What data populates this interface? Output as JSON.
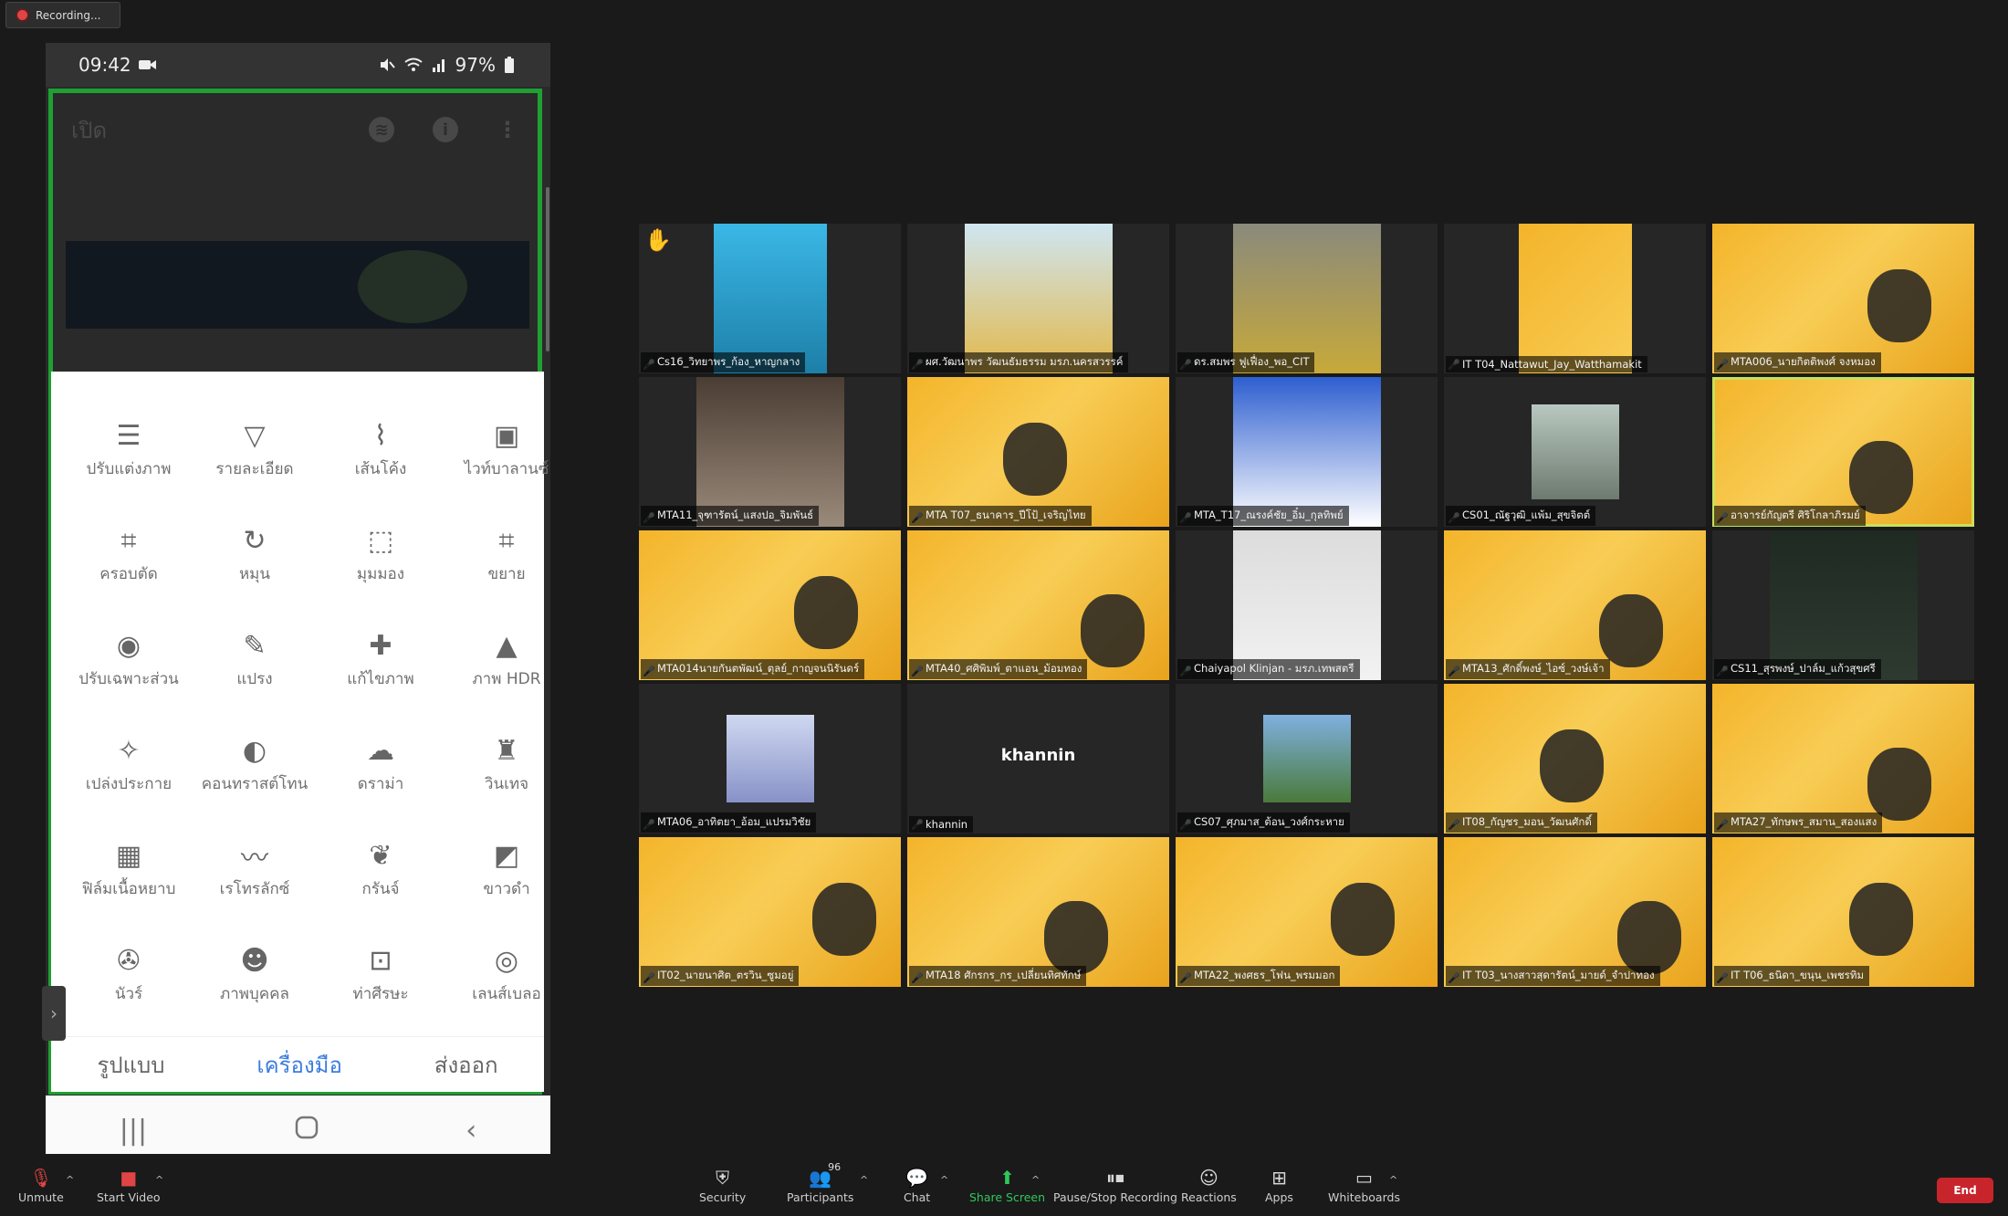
{
  "recording": {
    "label": "Recording..."
  },
  "phone": {
    "time": "09:42",
    "battery": "97%",
    "open_label": "เปิด",
    "tools": [
      {
        "label": "ปรับแต่งภาพ",
        "icon": "tune-sliders-icon"
      },
      {
        "label": "รายละเอียด",
        "icon": "details-triangle-icon"
      },
      {
        "label": "เส้นโค้ง",
        "icon": "curves-icon"
      },
      {
        "label": "ไวท์บาลานซ์",
        "icon": "white-balance-icon"
      },
      {
        "label": "ครอบตัด",
        "icon": "crop-icon"
      },
      {
        "label": "หมุน",
        "icon": "rotate-icon"
      },
      {
        "label": "มุมมอง",
        "icon": "perspective-icon"
      },
      {
        "label": "ขยาย",
        "icon": "expand-icon"
      },
      {
        "label": "ปรับเฉพาะส่วน",
        "icon": "selective-icon"
      },
      {
        "label": "แปรง",
        "icon": "brush-icon"
      },
      {
        "label": "แก้ไขภาพ",
        "icon": "healing-icon"
      },
      {
        "label": "ภาพ HDR",
        "icon": "hdr-mountain-icon"
      },
      {
        "label": "เปล่งประกาย",
        "icon": "glamour-glow-icon"
      },
      {
        "label": "คอนทราสต์โทน",
        "icon": "tonal-contrast-icon"
      },
      {
        "label": "ดราม่า",
        "icon": "drama-cloud-icon"
      },
      {
        "label": "วินเทจ",
        "icon": "vintage-lamp-icon"
      },
      {
        "label": "ฟิล์มเนื้อหยาบ",
        "icon": "grainy-film-icon"
      },
      {
        "label": "เรโทรลักซ์",
        "icon": "retrolux-mustache-icon"
      },
      {
        "label": "กรันจ์",
        "icon": "grunge-icon"
      },
      {
        "label": "ขาวดำ",
        "icon": "black-white-icon"
      },
      {
        "label": "นัวร์",
        "icon": "noir-reel-icon"
      },
      {
        "label": "ภาพบุคคล",
        "icon": "portrait-face-icon"
      },
      {
        "label": "ท่าศีรษะ",
        "icon": "head-pose-icon"
      },
      {
        "label": "เลนส์เบลอ",
        "icon": "lens-blur-icon"
      }
    ],
    "tabs": [
      "รูปแบบ",
      "เครื่องมือ",
      "ส่งออก"
    ],
    "active_tab": "เครื่องมือ"
  },
  "participants": [
    {
      "name": "Cs16_วิทยาพร_ก้อง_หาญกลาง",
      "cam": "c1",
      "hand": "✋"
    },
    {
      "name": "ผศ.วัฒนาพร วัฒนธัมธรรม มรภ.นครสวรรค์",
      "cam": "c2"
    },
    {
      "name": "ดร.สมพร ฟูเฟื่อง_พอ_CIT",
      "cam": "c3"
    },
    {
      "name": "IT T04_Nattawut_Jay_Watthamakit",
      "cam": "c4"
    },
    {
      "name": "MTA006_นายกิตติพงศ์ จงหมอง",
      "cam": "yellow"
    },
    {
      "name": "MTA11_จุฑารัตน์_แสงปอ_จิมพันธ์",
      "cam": "c5"
    },
    {
      "name": "MTA T07_ธนาคาร_ปีโป้_เจริญไทย",
      "cam": "yellow-mid"
    },
    {
      "name": "MTA_T17_ณรงค์ชัย_อิ๋ม_กุลทิพย์",
      "cam": "c6"
    },
    {
      "name": "CS01_ณัฐวุฒิ_แพ้ม_สุขจิตต์",
      "cam": "c7"
    },
    {
      "name": "อาจารย์กัญตรี ศิริโกลาภิรมย์",
      "cam": "yellow",
      "spotlight": true
    },
    {
      "name": "MTA014นายกันตพัฒน์_ตุลย์_กาญจนนิรันดร์",
      "cam": "yellow"
    },
    {
      "name": "MTA40_ศศิพิมพ์_ตาแอน_ม้อมทอง",
      "cam": "yellow"
    },
    {
      "name": "Chaiyapol Klinjan - มรภ.เทพสตรี",
      "cam": "c8"
    },
    {
      "name": "MTA13_ศักดิ์พงษ์_ไอซ์_วงษ์เจ้า",
      "cam": "yellow"
    },
    {
      "name": "CS11_สุรพงษ์_ปาล์ม_แก้วสุขศรี",
      "cam": "c9"
    },
    {
      "name": "MTA06_อาทิตยา_อ้อม_แปรมวิชัย",
      "cam": "c10"
    },
    {
      "name": "khannin",
      "cam": "none",
      "display": "khannin"
    },
    {
      "name": "CS07_ศุภมาส_ต้อน_วงศ์กระหาย",
      "cam": "c11"
    },
    {
      "name": "IT08_กัญชร_มอน_วัฒนศักดิ์",
      "cam": "yellow-mid"
    },
    {
      "name": "MTA27_ทักษพร_สมาน_สองแสง",
      "cam": "yellow"
    },
    {
      "name": "IT02_นายนาศิต_ตรวิน_ซูมอยู่",
      "cam": "yellow"
    },
    {
      "name": "MTA18 ศักรกร_กร_เปลี่ยนทิศทักษ์",
      "cam": "yellow"
    },
    {
      "name": "MTA22_พงศธร_โฟน_พรมมอก",
      "cam": "yellow"
    },
    {
      "name": "IT T03_นางสาวสุดารัตน์_มายด์_จำปาทอง",
      "cam": "yellow"
    },
    {
      "name": "IT T06_ธนิดา_ขนุน_เพชรทิม",
      "cam": "yellow"
    }
  ],
  "toolbar": {
    "unmute": "Unmute",
    "start_video": "Start Video",
    "security": "Security",
    "participants": "Participants",
    "participant_count": "96",
    "chat": "Chat",
    "share_screen": "Share Screen",
    "recording": "Pause/Stop Recording",
    "reactions": "Reactions",
    "apps": "Apps",
    "whiteboards": "Whiteboards",
    "end": "End"
  },
  "colors": {
    "accent_green": "#1fa032",
    "zoom_green": "#2fc85a",
    "end_red": "#c8242c",
    "tab_blue": "#3b7de0",
    "tile_yellow": "#f4b42a"
  }
}
